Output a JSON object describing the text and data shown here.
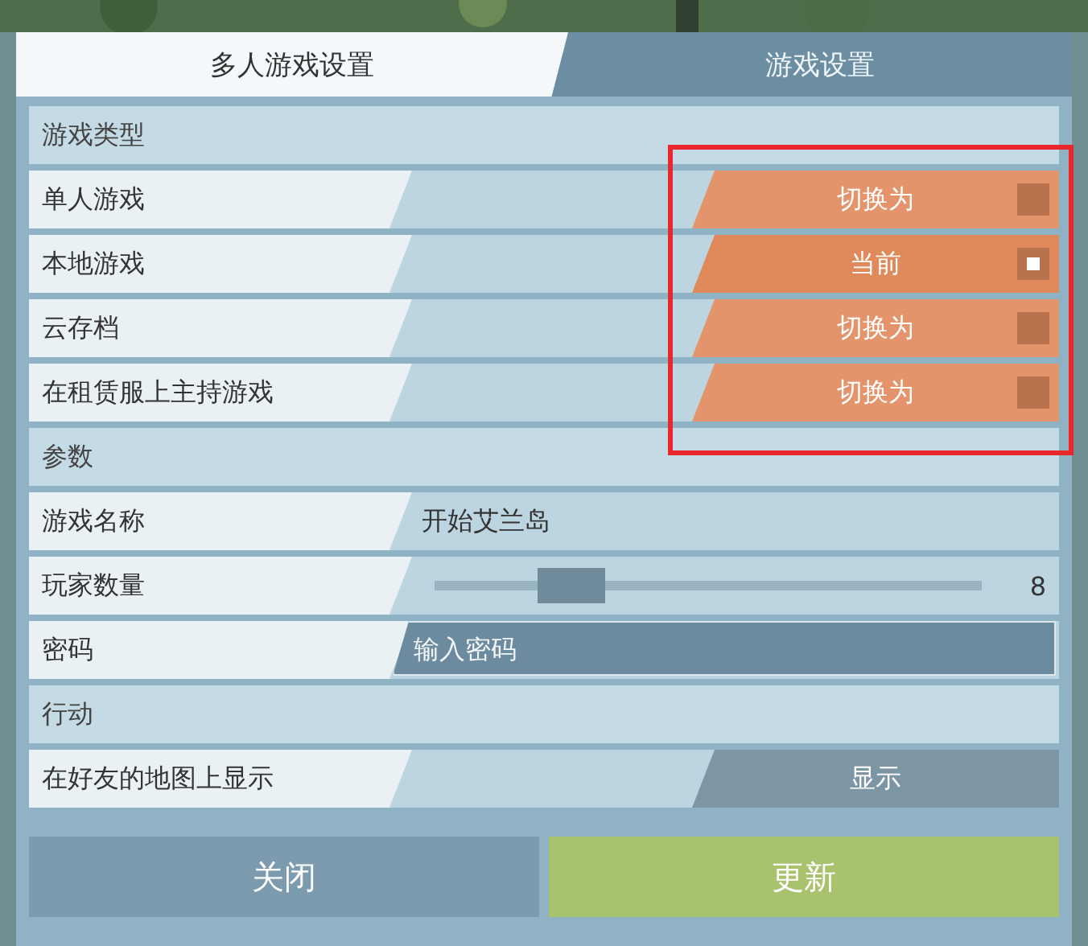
{
  "tabs": [
    {
      "label": "多人游戏设置",
      "selected": true
    },
    {
      "label": "游戏设置",
      "selected": false
    }
  ],
  "sections": [
    {
      "title": "游戏类型",
      "rows": [
        {
          "kind": "mode",
          "label": "单人游戏",
          "button": "切换为",
          "selected": false
        },
        {
          "kind": "mode",
          "label": "本地游戏",
          "button": "当前",
          "selected": true
        },
        {
          "kind": "mode",
          "label": "云存档",
          "button": "切换为",
          "selected": false
        },
        {
          "kind": "mode",
          "label": "在租赁服上主持游戏",
          "button": "切换为",
          "selected": false
        }
      ]
    },
    {
      "title": "参数",
      "rows": [
        {
          "kind": "text",
          "label": "游戏名称",
          "value": "开始艾兰岛"
        },
        {
          "kind": "slider",
          "label": "玩家数量",
          "level": 0.25,
          "reading": "8"
        },
        {
          "kind": "input",
          "label": "密码",
          "placeholder": "输入密码"
        }
      ]
    },
    {
      "title": "行动",
      "rows": [
        {
          "kind": "toggle",
          "label": "在好友的地图上显示",
          "button": "显示"
        }
      ]
    }
  ],
  "buttons": [
    {
      "kind": "close",
      "label": "关闭"
    },
    {
      "kind": "confirm",
      "label": "更新"
    }
  ]
}
